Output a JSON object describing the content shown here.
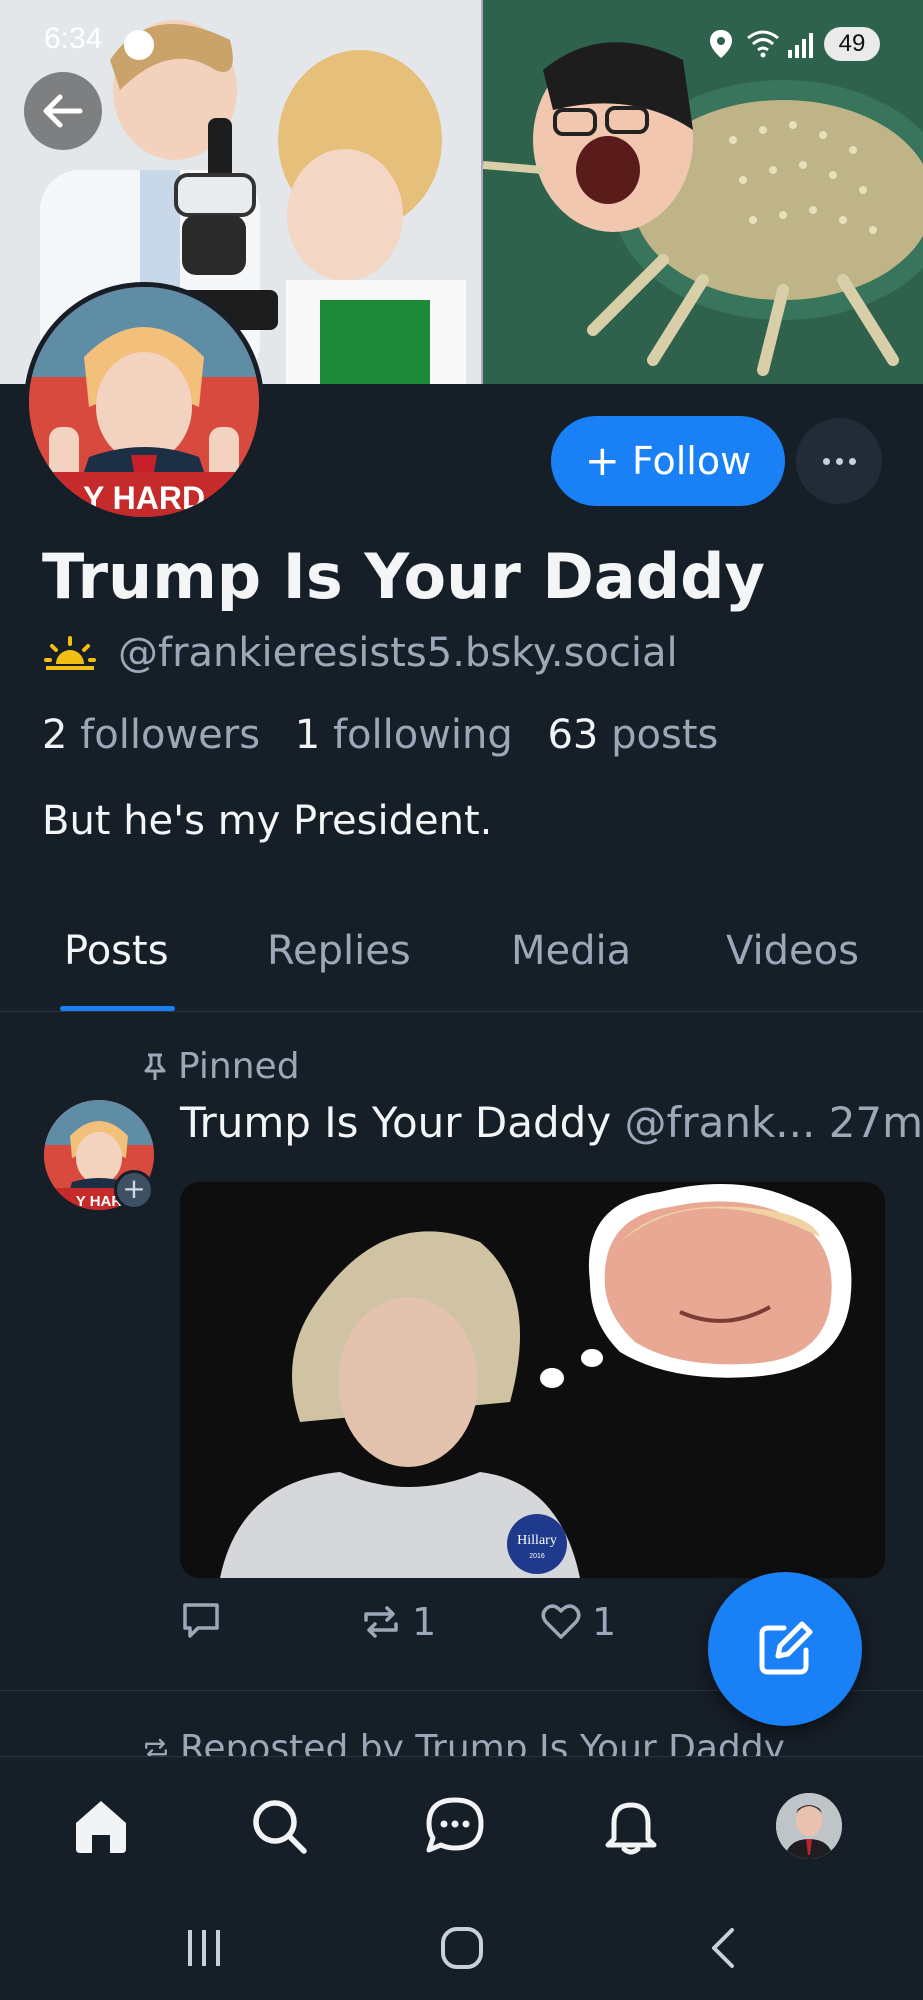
{
  "status_bar": {
    "time": "6:34",
    "battery": "49"
  },
  "profile": {
    "display_name": "Trump Is Your Daddy",
    "handle": "@frankieresists5.bsky.social",
    "followers_count": "2",
    "followers_label": "followers",
    "following_count": "1",
    "following_label": "following",
    "posts_count": "63",
    "posts_label": "posts",
    "bio": "But he's my President.",
    "avatar_text": "Y HARD"
  },
  "actions": {
    "follow_label": "Follow"
  },
  "tabs": [
    {
      "label": "Posts",
      "active": true
    },
    {
      "label": "Replies",
      "active": false
    },
    {
      "label": "Media",
      "active": false
    },
    {
      "label": "Videos",
      "active": false
    }
  ],
  "post": {
    "pinned_label": "Pinned",
    "author": "Trump Is Your Daddy",
    "handle_trunc": "@frank...",
    "time": "27m",
    "avatar_text": "Y HAR",
    "badge_text": "Hillary",
    "badge_year": "2016",
    "reply_count": "",
    "repost_count": "1",
    "like_count": "1"
  },
  "next_post": {
    "reposted_label": "Reposted by Trump Is Your Daddy"
  },
  "colors": {
    "background": "#161e27",
    "accent": "#1a80f5",
    "muted_text": "#9aa8b8"
  },
  "icons": {
    "back": "arrow-left-icon",
    "more": "ellipsis-icon",
    "pin": "pin-icon",
    "reply": "speech-bubble-icon",
    "repost": "repost-icon",
    "like": "heart-icon",
    "compose": "compose-icon",
    "nav": [
      "home-icon",
      "search-icon",
      "chat-icon",
      "bell-icon"
    ]
  }
}
